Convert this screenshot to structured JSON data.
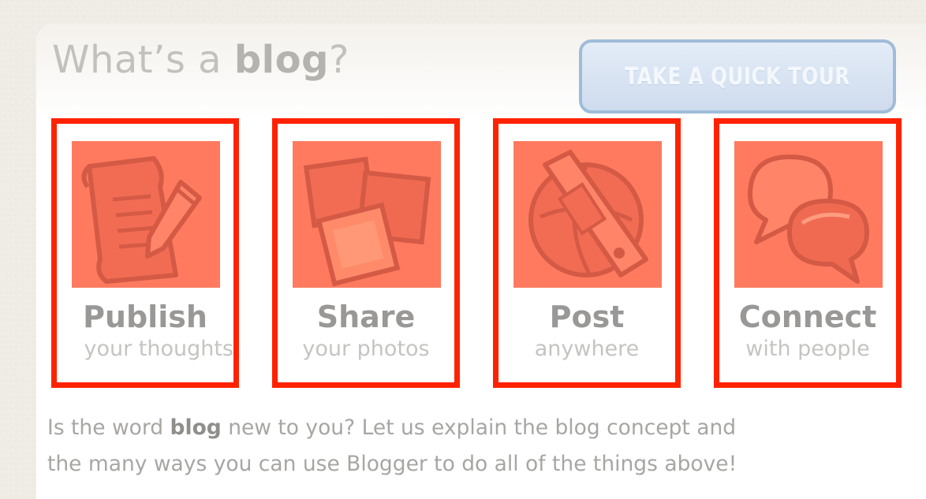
{
  "header": {
    "title_prefix": "What’s a ",
    "title_bold": "blog",
    "title_suffix": "?",
    "tour_button_label": "TAKE A QUICK TOUR",
    "tour_button_color": "#cfdcee"
  },
  "features": [
    {
      "title": "Publish",
      "subtitle": "your thoughts",
      "icon": "document-pencil-icon"
    },
    {
      "title": "Share",
      "subtitle": "your photos",
      "icon": "photos-icon"
    },
    {
      "title": "Post",
      "subtitle": "anywhere",
      "icon": "mobile-phone-globe-icon"
    },
    {
      "title": "Connect",
      "subtitle": "with people",
      "icon": "speech-bubbles-icon"
    }
  ],
  "description": {
    "line1_prefix": "Is the word ",
    "line1_bold": "blog",
    "line1_suffix": " new to you? Let us explain the blog concept and",
    "line2": "the many ways you can use Blogger to do all of the things above!"
  },
  "colors": {
    "highlight_border": "#ff2200",
    "tile_fill": "#ff7a5f",
    "page_background": "#efebe5"
  }
}
